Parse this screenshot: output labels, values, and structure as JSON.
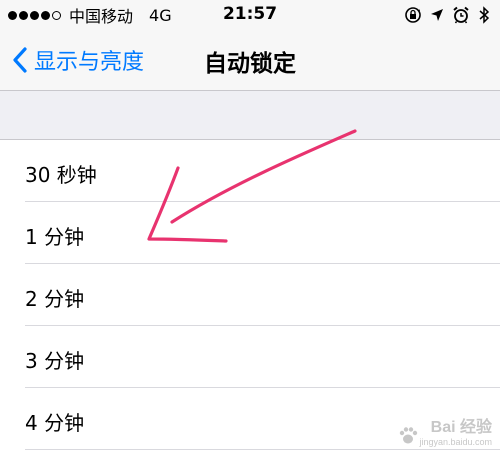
{
  "status_bar": {
    "carrier": "中国移动",
    "network": "4G",
    "time": "21:57",
    "signal_filled": 4,
    "signal_total": 5,
    "icons": [
      "rotation-lock-icon",
      "location-icon",
      "alarm-icon",
      "bluetooth-icon"
    ]
  },
  "nav": {
    "back_label": "显示与亮度",
    "title": "自动锁定",
    "accent_color": "#007aff"
  },
  "options": [
    {
      "label": "30 秒钟"
    },
    {
      "label": "1 分钟"
    },
    {
      "label": "2 分钟"
    },
    {
      "label": "3 分钟"
    },
    {
      "label": "4 分钟"
    }
  ],
  "annotation": {
    "color": "#e8336f",
    "points_to": "1 分钟"
  },
  "watermark": {
    "text": "Bai 经验",
    "sub": "jingyan.baidu.com"
  }
}
